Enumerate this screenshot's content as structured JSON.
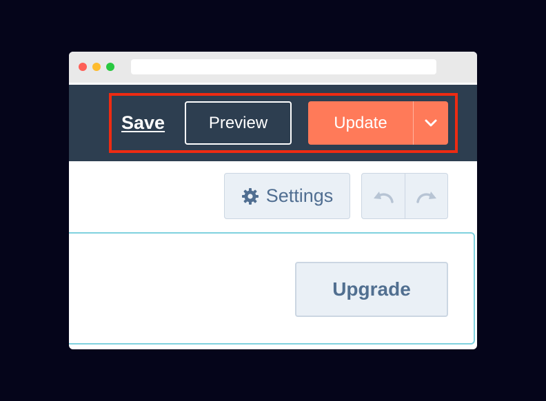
{
  "header": {
    "save_label": "Save",
    "preview_label": "Preview",
    "update_label": "Update",
    "dropdown_icon": "chevron-down-icon"
  },
  "toolbar": {
    "settings_label": "Settings",
    "settings_icon": "gear-icon",
    "undo_icon": "undo-icon",
    "redo_icon": "redo-icon"
  },
  "panel": {
    "upgrade_label": "Upgrade"
  },
  "colors": {
    "page_background": "#05051a",
    "topbar": "#2d3e50",
    "accent": "#ff7a59",
    "highlight": "#ee2b12",
    "panel_border": "#7fd1de"
  }
}
